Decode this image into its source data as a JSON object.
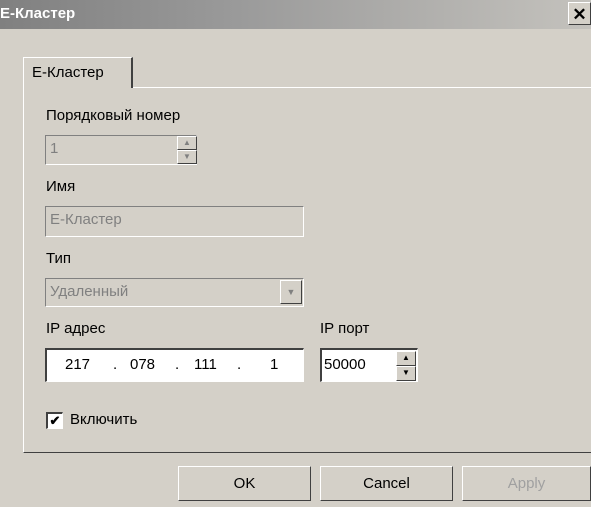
{
  "window": {
    "title": "E-Кластер",
    "close_glyph": "✕"
  },
  "tabs": [
    {
      "label": "E-Кластер"
    }
  ],
  "form": {
    "order_label": "Порядковый номер",
    "order_value": "1",
    "name_label": "Имя",
    "name_value": "E-Кластер",
    "type_label": "Тип",
    "type_value": "Удаленный",
    "ip_label": "IP адрес",
    "ip": [
      "217",
      "078",
      "111",
      "1"
    ],
    "ip_sep": ".",
    "port_label": "IP порт",
    "port_value": "50000",
    "enable_label": "Включить",
    "enable_checked": true
  },
  "buttons": {
    "ok": "OK",
    "cancel": "Cancel",
    "apply": "Apply"
  },
  "icons": {
    "spin_up": "▲",
    "spin_down": "▼",
    "dropdown": "▼",
    "check": "✔"
  }
}
